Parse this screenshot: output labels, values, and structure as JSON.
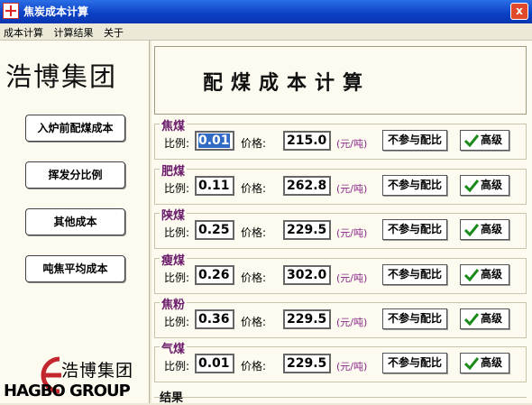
{
  "window": {
    "title": "焦炭成本计算",
    "close_label": "x"
  },
  "menu": [
    "成本计算",
    "计算结果",
    "关于"
  ],
  "sidebar": {
    "brand": "浩博集团",
    "buttons": [
      "入炉前配煤成本",
      "挥发分比例",
      "其他成本",
      "吨焦平均成本"
    ],
    "logo_cn": "浩博集团",
    "logo_en": "HAGBO GROUP"
  },
  "header": {
    "title": "配煤成本计算"
  },
  "labels": {
    "ratio": "比例:",
    "price": "价格:",
    "unit": "(元/吨)",
    "exclude": "不参与配比",
    "advanced": "高级"
  },
  "coals": [
    {
      "name": "焦煤",
      "ratio": "0.01",
      "price": "215.0"
    },
    {
      "name": "肥煤",
      "ratio": "0.11",
      "price": "262.8"
    },
    {
      "name": "陕煤",
      "ratio": "0.25",
      "price": "229.5"
    },
    {
      "name": "瘦煤",
      "ratio": "0.26",
      "price": "302.0"
    },
    {
      "name": "焦粉",
      "ratio": "0.36",
      "price": "229.5"
    },
    {
      "name": "气煤",
      "ratio": "0.01",
      "price": "229.5"
    }
  ],
  "result": {
    "label": "结果"
  },
  "colors": {
    "title_bar": "#0a3fc4",
    "panel_bg": "#fdfbef",
    "coal_name": "#6a1a6a",
    "check": "#1a8a1a"
  }
}
